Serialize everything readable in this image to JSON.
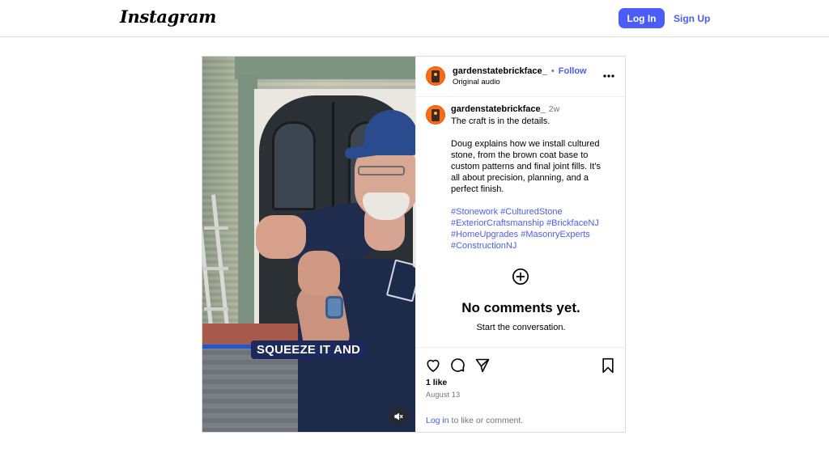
{
  "header": {
    "logo": "Instagram",
    "login_label": "Log In",
    "signup_label": "Sign Up"
  },
  "media": {
    "caption_overlay": "SQUEEZE IT AND",
    "mute_icon": "volume-muted-icon"
  },
  "post": {
    "username": "gardenstatebrickface_",
    "separator": "•",
    "follow_label": "Follow",
    "audio_label": "Original audio",
    "more_icon": "more-horizontal-icon",
    "caption": {
      "username": "gardenstatebrickface_",
      "time_ago": "2w",
      "lines": [
        "The craft is in the details.",
        "Doug explains how we install cultured",
        "stone, from the brown coat base to",
        "custom patterns and final joint fills. It’s",
        "all about precision, planning, and a",
        "perfect finish."
      ],
      "hashtag_lines": [
        "#Stonework #CulturedStone",
        "#ExteriorCraftsmanship #BrickfaceNJ",
        "#HomeUpgrades #MasonryExperts",
        "#ConstructionNJ"
      ]
    },
    "no_comments": {
      "icon": "add-circle-icon",
      "title": "No comments yet.",
      "subtitle": "Start the conversation."
    },
    "actions": {
      "like_icon": "heart-icon",
      "comment_icon": "comment-icon",
      "share_icon": "share-icon",
      "save_icon": "bookmark-icon"
    },
    "likes": "1 like",
    "date": "August 13",
    "login_link": "Log in",
    "login_suffix": " to like or comment."
  },
  "colors": {
    "accent": "#4a5df9",
    "border": "#dbdbdb",
    "muted_text": "#737373",
    "avatar": "#ff6a13"
  }
}
